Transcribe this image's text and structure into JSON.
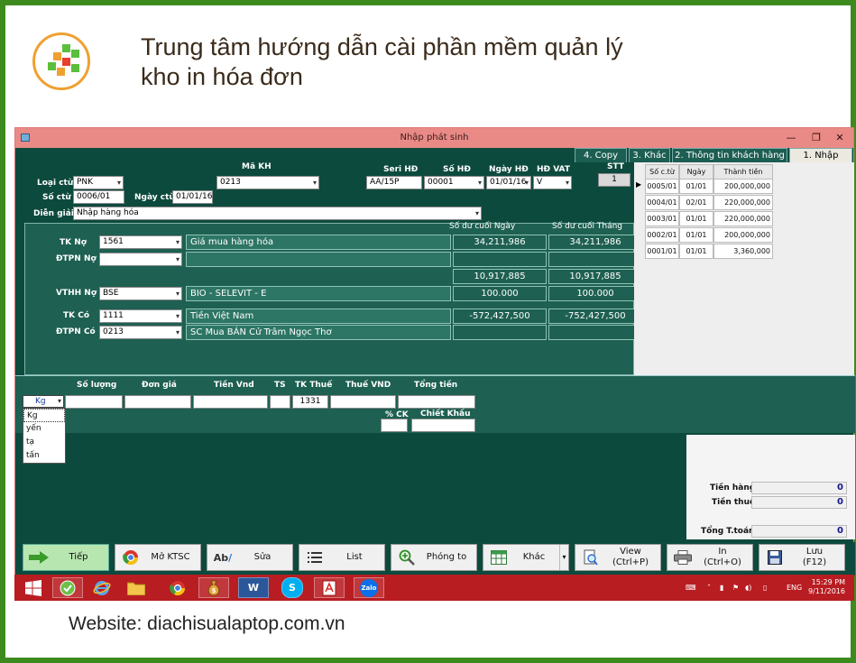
{
  "header": {
    "title_line1": "Trung tâm hướng dẫn cài phần mềm quản lý",
    "title_line2": "kho in hóa đơn"
  },
  "footer": {
    "website": "Website: diachisualaptop.com.vn"
  },
  "window": {
    "title": "Nhập phát sinh",
    "controls": [
      "—",
      "❐",
      "✕"
    ]
  },
  "tabs": [
    "4. Copy",
    "3. Khác",
    "2. Thông tin khách hàng",
    "1. Nhập"
  ],
  "form": {
    "ma_kh_label": "Mã KH",
    "ma_kh_value": "0213",
    "seri_hd_label": "Seri HĐ",
    "seri_hd_value": "AA/15P",
    "so_hd_label": "Số HĐ",
    "so_hd_value": "00001",
    "ngay_hd_label": "Ngày HĐ",
    "ngay_hd_value": "01/01/16",
    "hd_vat_label": "HĐ VAT",
    "hd_vat_value": "V",
    "stt_label": "STT",
    "stt_value": "1",
    "loai_ctu_label": "Loại ctừ",
    "loai_ctu_value": "PNK",
    "so_ctu_label": "Số ctừ",
    "so_ctu_value": "0006/01",
    "ngay_ctu_label": "Ngày ctừ",
    "ngay_ctu_value": "01/01/16",
    "dien_giai_label": "Diễn giải",
    "dien_giai_value": "Nhập hàng hóa"
  },
  "accounts": {
    "so_du_ngay_label": "Số dư cuối Ngày",
    "so_du_thang_label": "Số dư cuối Tháng",
    "tk_no_label": "TK Nợ",
    "tk_no_value": "1561",
    "tk_no_name": "Giá mua hàng hóa",
    "tk_no_ngay": "34,211,986",
    "tk_no_thang": "34,211,986",
    "dtpn_no_label": "ĐTPN Nợ",
    "row3_ngay": "10,917,885",
    "row3_thang": "10,917,885",
    "vthh_no_label": "VTHH Nợ",
    "vthh_no_value": "BSE",
    "vthh_no_name": "BIO - SELEVIT - E",
    "vthh_ngay": "100.000",
    "vthh_thang": "100.000",
    "tk_co_label": "TK Có",
    "tk_co_value": "1111",
    "tk_co_name": "Tiền Việt Nam",
    "tk_co_ngay": "-572,427,500",
    "tk_co_thang": "-752,427,500",
    "dtpn_co_label": "ĐTPN Có",
    "dtpn_co_value": "0213",
    "dtpn_co_name": "SC Mua BÁN Cử Trâm Ngọc Thơ"
  },
  "grid": {
    "headers": [
      "Số c.từ",
      "Ngày",
      "Thành tiền"
    ],
    "rows": [
      [
        "0005/01",
        "01/01",
        "200,000,000"
      ],
      [
        "0004/01",
        "02/01",
        "220,000,000"
      ],
      [
        "0003/01",
        "01/01",
        "220,000,000"
      ],
      [
        "0002/01",
        "01/01",
        "200,000,000"
      ],
      [
        "0001/01",
        "01/01",
        "3,360,000"
      ]
    ]
  },
  "detail": {
    "so_luong_label": "Số lượng",
    "don_gia_label": "Đơn giá",
    "tien_vnd_label": "Tiền Vnd",
    "ts_label": "TS",
    "tk_thue_label": "TK Thuế",
    "tk_thue_value": "1331",
    "thue_vnd_label": "Thuế VND",
    "tong_tien_label": "Tổng tiền",
    "ck_label": "% CK",
    "chiet_khau_label": "Chiết Khấu",
    "unit_selected": "Kg",
    "unit_options": [
      "Kg",
      "yến",
      "tạ",
      "tấn"
    ]
  },
  "totals": {
    "tien_hang_label": "Tiền hàng",
    "tien_hang_value": "0",
    "tien_thue_label": "Tiền thuế",
    "tien_thue_value": "0",
    "tong_toan_label": "Tổng T.toán",
    "tong_toan_value": "0"
  },
  "buttons": {
    "tiep": "Tiếp",
    "mo_ktsc": "Mở KTSC",
    "sua": "Sửa",
    "list": "List",
    "phong_to": "Phóng to",
    "khac": "Khác",
    "view": "View (Ctrl+P)",
    "in_line1": "In",
    "in_line2": "(Ctrl+O)",
    "luu_line1": "Lưu",
    "luu_line2": "(F12)"
  },
  "taskbar": {
    "word_label": "W",
    "skype_label": "S",
    "zalo_label": "Zalo",
    "lang": "ENG",
    "time": "15:29 PM",
    "date": "9/11/2016"
  },
  "colors": {
    "frame_green": "#3d8b1e",
    "window_dark_teal": "#0d4a3e",
    "panel_teal": "#1e6052",
    "titlebar_pink": "#e98a86",
    "taskbar_red": "#b81d22"
  }
}
